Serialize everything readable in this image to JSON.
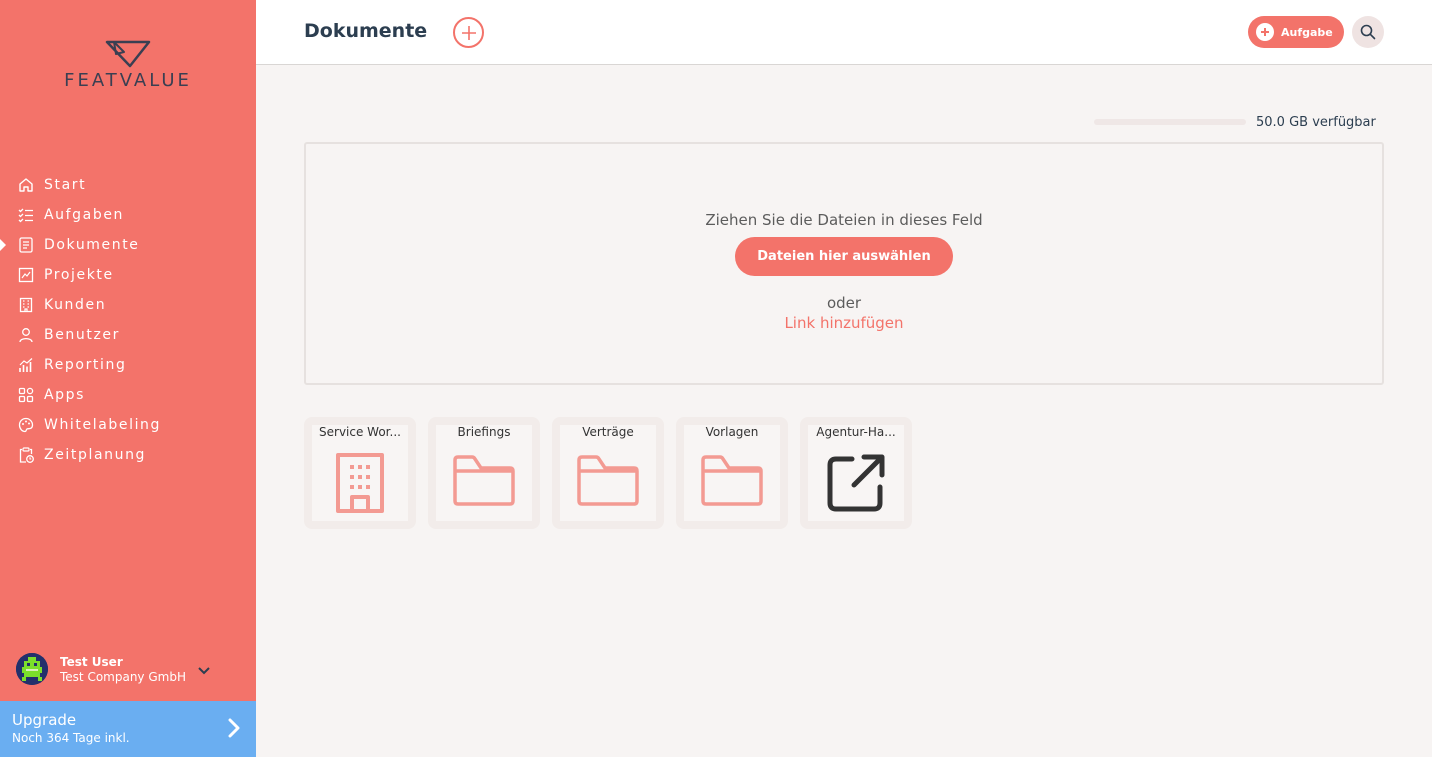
{
  "brand": {
    "name": "FEATVALUE"
  },
  "sidebar": {
    "items": [
      {
        "label": "Start",
        "icon": "home-icon"
      },
      {
        "label": "Aufgaben",
        "icon": "tasks-icon"
      },
      {
        "label": "Dokumente",
        "icon": "document-icon",
        "active": true
      },
      {
        "label": "Projekte",
        "icon": "projects-icon"
      },
      {
        "label": "Kunden",
        "icon": "building-icon"
      },
      {
        "label": "Benutzer",
        "icon": "user-icon"
      },
      {
        "label": "Reporting",
        "icon": "chart-icon"
      },
      {
        "label": "Apps",
        "icon": "apps-icon"
      },
      {
        "label": "Whitelabeling",
        "icon": "palette-icon"
      },
      {
        "label": "Zeitplanung",
        "icon": "clipboard-clock-icon"
      }
    ],
    "user": {
      "name": "Test User",
      "company": "Test Company GmbH"
    },
    "upgrade": {
      "title": "Upgrade",
      "subtitle": "Noch 364 Tage inkl."
    }
  },
  "header": {
    "title": "Dokumente",
    "task_button": "Aufgabe"
  },
  "storage": {
    "text": "50.0 GB verfügbar",
    "used_fraction": 0
  },
  "dropzone": {
    "instruction": "Ziehen Sie die Dateien in dieses Feld",
    "button": "Dateien hier auswählen",
    "or": "oder",
    "link": "Link hinzufügen"
  },
  "folders": [
    {
      "label": "Service Wor...",
      "icon": "building-icon"
    },
    {
      "label": "Briefings",
      "icon": "folder-icon"
    },
    {
      "label": "Verträge",
      "icon": "folder-icon"
    },
    {
      "label": "Vorlagen",
      "icon": "folder-icon"
    },
    {
      "label": "Agentur-Ha...",
      "icon": "external-link-icon"
    }
  ],
  "colors": {
    "accent": "#f3736a",
    "upgrade": "#6aaef1",
    "text": "#2c3e50",
    "folder_icon": "#f39a92"
  }
}
